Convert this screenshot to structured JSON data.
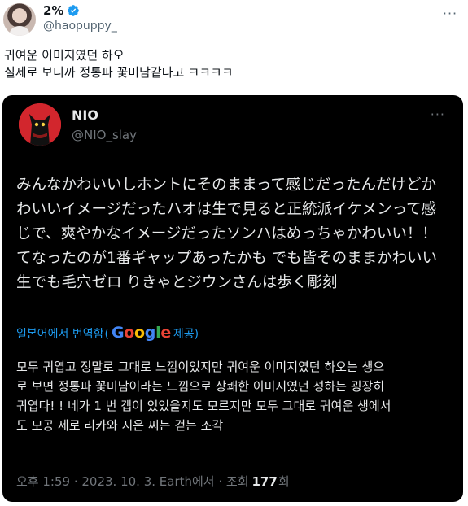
{
  "tweet": {
    "display_name": "2%",
    "handle": "@haopuppy_",
    "more_label": "···",
    "text_lines": [
      "귀여운 이미지였던 하오",
      "실제로 보니까 정통파 꽃미남같다고 ㅋㅋㅋㅋ"
    ]
  },
  "quoted": {
    "display_name": "NIO",
    "handle": "@NIO_slay",
    "more_label": "···",
    "original_lines": [
      "みんなかわいいしホントにそのままって感じだったんだけどか",
      "わいいイメージだったハオは生で見ると正統派イケメンって感",
      "じで、爽やかなイメージだったソンハはめっちゃかわいい！！",
      "てなったのが1番ギャップあったかも でも皆そのままかわいい",
      "生でも毛穴ゼロ りきゃとジウンさんは歩く彫刻"
    ],
    "translated_prefix": "일본어에서 번역함",
    "translated_suffix": "제공)",
    "google_letters": [
      "G",
      "o",
      "o",
      "g",
      "l",
      "e"
    ],
    "translation_lines": [
      "모두 귀엽고 정말로 그대로 느낌이었지만 귀여운 이미지였던 하오는 생으",
      "로 보면 정통파 꽃미남이라는 느낌으로 상쾌한 이미지였던 성하는 굉장히",
      "귀엽다! ! 네가 1 번 갭이 있었을지도 모르지만 모두 그대로 귀여운 생에서",
      "도 모공 제로 리카와 지은 씨는 걷는 조각"
    ],
    "timestamp": "오후 1:59 · 2023. 10. 3. Earth에서 · 조회",
    "views_count": "177",
    "views_suffix": "회"
  },
  "colors": {
    "accent": "#1d9bf0",
    "card_bg": "#000000",
    "muted": "#71767b",
    "quoted_avatar_bg": "#d2262d"
  }
}
